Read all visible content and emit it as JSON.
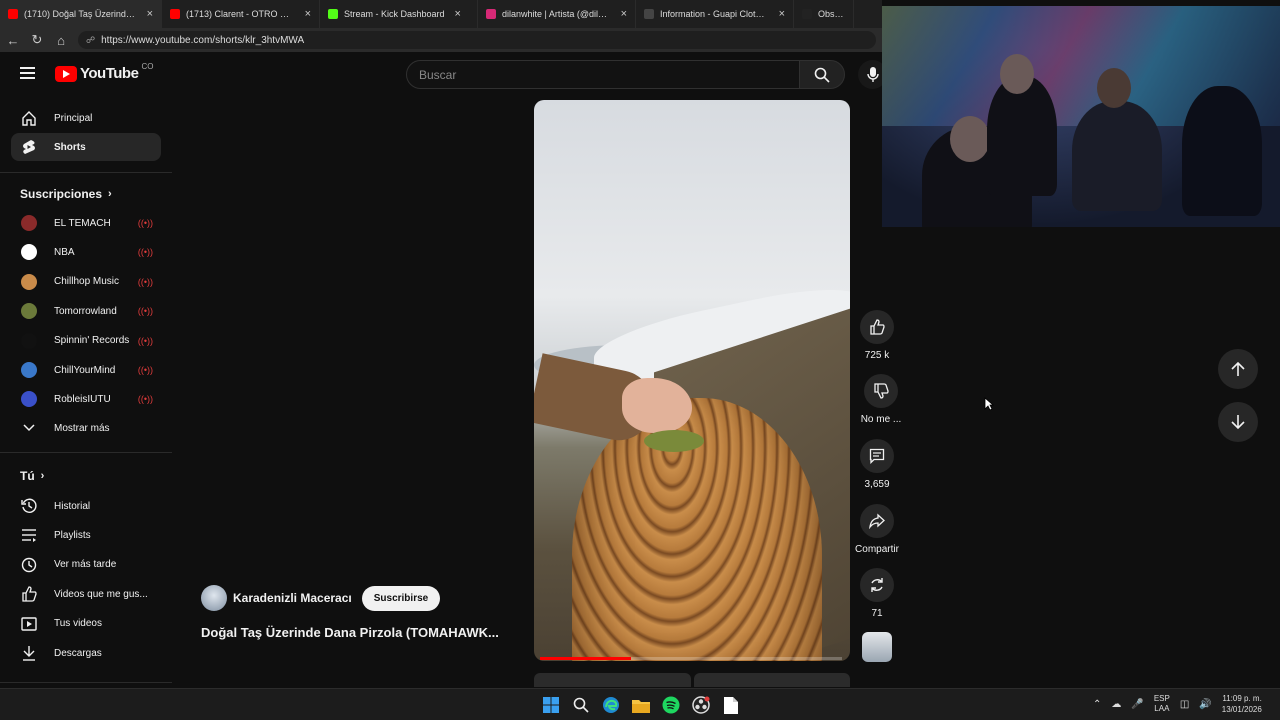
{
  "browser": {
    "tabs": [
      {
        "title": "(1710) Doğal Taş Üzerinde Da",
        "color": "#ff0000",
        "active": true
      },
      {
        "title": "(1713) Clarent - OTRO MOMENTO",
        "color": "#ff0000",
        "active": false
      },
      {
        "title": "Stream - Kick Dashboard",
        "color": "#53fc18",
        "active": false
      },
      {
        "title": "dilanwhite | Artista (@dilanwhite",
        "color": "#d62976",
        "active": false
      },
      {
        "title": "Information - Guapi Clothing - Ch",
        "color": "#444444",
        "active": false
      },
      {
        "title": "Obsidian Black E",
        "color": "#222222",
        "active": false
      }
    ],
    "url": "https://www.youtube.com/shorts/klr_3htvMWA"
  },
  "header": {
    "logo_text": "YouTube",
    "logo_country": "CO",
    "search_placeholder": "Buscar"
  },
  "sidebar": {
    "main": [
      {
        "label": "Principal",
        "icon": "home-icon"
      },
      {
        "label": "Shorts",
        "icon": "shorts-icon",
        "active": true
      }
    ],
    "subscriptions_title": "Suscripciones",
    "subscriptions": [
      {
        "label": "EL TEMACH",
        "color": "#8a2a2a"
      },
      {
        "label": "NBA",
        "color": "#ffffff"
      },
      {
        "label": "Chillhop Music",
        "color": "#c98b4a"
      },
      {
        "label": "Tomorrowland",
        "color": "#6b7a3a"
      },
      {
        "label": "Spinnin' Records",
        "color": "#111111"
      },
      {
        "label": "ChillYourMind",
        "color": "#3a78c9"
      },
      {
        "label": "RobleisIUTU",
        "color": "#3a50c9"
      }
    ],
    "show_more": "Mostrar más",
    "you_title": "Tú",
    "you_items": [
      {
        "label": "Historial",
        "icon": "history-icon"
      },
      {
        "label": "Playlists",
        "icon": "playlists-icon"
      },
      {
        "label": "Ver más tarde",
        "icon": "watch-later-icon"
      },
      {
        "label": "Videos que me gus...",
        "icon": "liked-icon"
      },
      {
        "label": "Tus videos",
        "icon": "your-videos-icon"
      },
      {
        "label": "Descargas",
        "icon": "downloads-icon"
      }
    ]
  },
  "short": {
    "channel_name": "Karadenizli Maceracı",
    "subscribe_label": "Suscribirse",
    "title": "Doğal Taş Üzerinde Dana Pirzola (TOMAHAWK...",
    "progress": 0.3,
    "actions": {
      "likes": "725 k",
      "dislike_label": "No me ...",
      "comments": "3,659",
      "share_label": "Compartir",
      "remix_count": "71"
    }
  },
  "taskbar": {
    "lang_top": "ESP",
    "lang_bottom": "LAA",
    "time": "11:09 p. m.",
    "date": "13/01/2026"
  }
}
